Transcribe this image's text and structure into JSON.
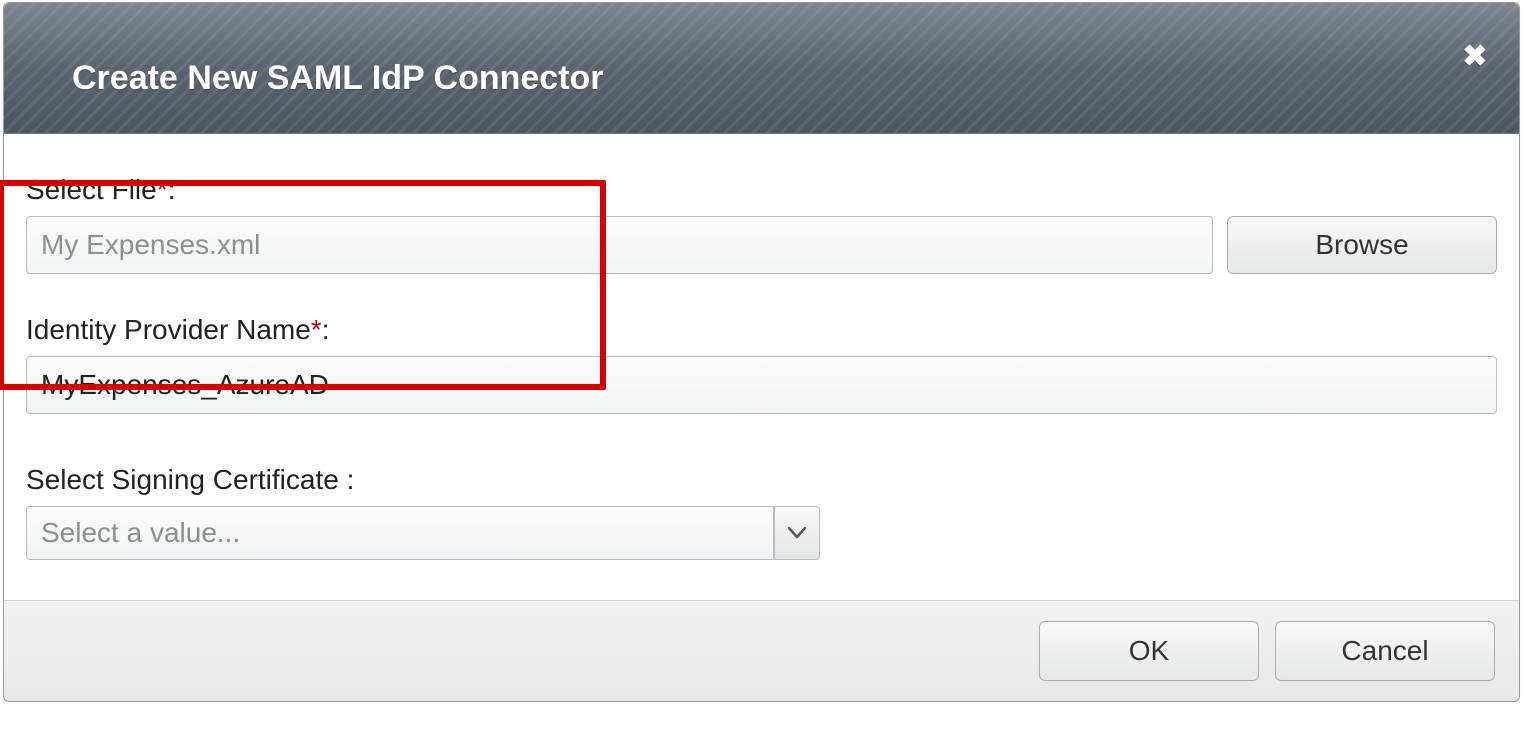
{
  "dialog": {
    "title": "Create New SAML IdP Connector",
    "close_label": "Close"
  },
  "fields": {
    "select_file": {
      "label": "Select File",
      "required_mark": "*",
      "separator": ":",
      "value": "My Expenses.xml",
      "browse_label": "Browse"
    },
    "idp_name": {
      "label": "Identity Provider Name",
      "required_mark": "*",
      "separator": ":",
      "value": "MyExpenses_AzureAD"
    },
    "signing_cert": {
      "label": "Select Signing Certificate",
      "separator": "  :",
      "placeholder": "Select a value..."
    }
  },
  "footer": {
    "ok_label": "OK",
    "cancel_label": "Cancel"
  }
}
